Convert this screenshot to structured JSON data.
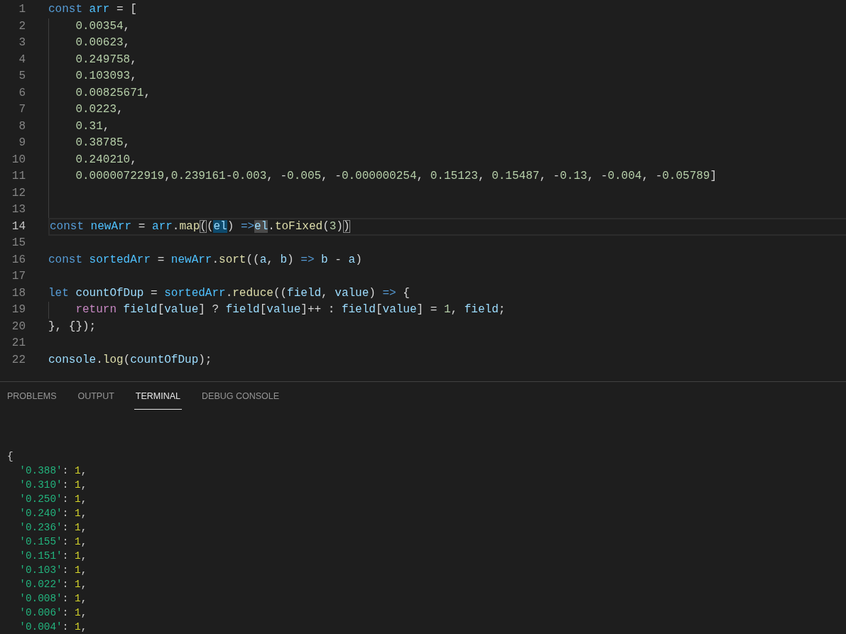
{
  "editor": {
    "lines": [
      {
        "line_number": "1",
        "current": false,
        "indented": false,
        "tokens": [
          {
            "text": "const ",
            "kind": "keyword"
          },
          {
            "text": "arr",
            "kind": "constant"
          },
          {
            "text": " = [",
            "kind": "punct"
          }
        ]
      },
      {
        "line_number": "2",
        "current": false,
        "indented": true,
        "tokens": [
          {
            "text": "0.00354",
            "kind": "number"
          },
          {
            "text": ",",
            "kind": "punct"
          }
        ]
      },
      {
        "line_number": "3",
        "current": false,
        "indented": true,
        "tokens": [
          {
            "text": "0.00623",
            "kind": "number"
          },
          {
            "text": ",",
            "kind": "punct"
          }
        ]
      },
      {
        "line_number": "4",
        "current": false,
        "indented": true,
        "tokens": [
          {
            "text": "0.249758",
            "kind": "number"
          },
          {
            "text": ",",
            "kind": "punct"
          }
        ]
      },
      {
        "line_number": "5",
        "current": false,
        "indented": true,
        "tokens": [
          {
            "text": "0.103093",
            "kind": "number"
          },
          {
            "text": ",",
            "kind": "punct"
          }
        ]
      },
      {
        "line_number": "6",
        "current": false,
        "indented": true,
        "tokens": [
          {
            "text": "0.00825671",
            "kind": "number"
          },
          {
            "text": ",",
            "kind": "punct"
          }
        ]
      },
      {
        "line_number": "7",
        "current": false,
        "indented": true,
        "tokens": [
          {
            "text": "0.0223",
            "kind": "number"
          },
          {
            "text": ",",
            "kind": "punct"
          }
        ]
      },
      {
        "line_number": "8",
        "current": false,
        "indented": true,
        "tokens": [
          {
            "text": "0.31",
            "kind": "number"
          },
          {
            "text": ",",
            "kind": "punct"
          }
        ]
      },
      {
        "line_number": "9",
        "current": false,
        "indented": true,
        "tokens": [
          {
            "text": "0.38785",
            "kind": "number"
          },
          {
            "text": ",",
            "kind": "punct"
          }
        ]
      },
      {
        "line_number": "10",
        "current": false,
        "indented": true,
        "tokens": [
          {
            "text": "0.240210",
            "kind": "number"
          },
          {
            "text": ",",
            "kind": "punct"
          }
        ]
      },
      {
        "line_number": "11",
        "current": false,
        "indented": true,
        "tokens": [
          {
            "text": "0.00000722919",
            "kind": "number"
          },
          {
            "text": ",",
            "kind": "punct"
          },
          {
            "text": "0.239161",
            "kind": "number"
          },
          {
            "text": "-",
            "kind": "punct"
          },
          {
            "text": "0.003",
            "kind": "number"
          },
          {
            "text": ", -",
            "kind": "punct"
          },
          {
            "text": "0.005",
            "kind": "number"
          },
          {
            "text": ", -",
            "kind": "punct"
          },
          {
            "text": "0.000000254",
            "kind": "number"
          },
          {
            "text": ", ",
            "kind": "punct"
          },
          {
            "text": "0.15123",
            "kind": "number"
          },
          {
            "text": ", ",
            "kind": "punct"
          },
          {
            "text": "0.15487",
            "kind": "number"
          },
          {
            "text": ", -",
            "kind": "punct"
          },
          {
            "text": "0.13",
            "kind": "number"
          },
          {
            "text": ", -",
            "kind": "punct"
          },
          {
            "text": "0.004",
            "kind": "number"
          },
          {
            "text": ", -",
            "kind": "punct"
          },
          {
            "text": "0.05789",
            "kind": "number"
          },
          {
            "text": "]",
            "kind": "punct"
          }
        ]
      },
      {
        "line_number": "12",
        "current": false,
        "indented": true
      },
      {
        "line_number": "13",
        "current": false,
        "indented": true
      },
      {
        "line_number": "14",
        "current": true,
        "indented": false,
        "tokens": [
          {
            "text": "const ",
            "kind": "keyword"
          },
          {
            "text": "newArr",
            "kind": "constant"
          },
          {
            "text": " = ",
            "kind": "punct"
          },
          {
            "text": "arr",
            "kind": "constant"
          },
          {
            "text": ".",
            "kind": "punct"
          },
          {
            "text": "map",
            "kind": "function"
          },
          {
            "text": "(",
            "kind": "punct",
            "matching_bracket": true
          },
          {
            "text": "(",
            "kind": "punct"
          },
          {
            "text": "el",
            "kind": "variable",
            "write_highlight": true
          },
          {
            "text": ") ",
            "kind": "punct"
          },
          {
            "text": "=>",
            "kind": "keyword"
          },
          {
            "text": "el",
            "kind": "variable",
            "read_highlight": true
          },
          {
            "text": ".",
            "kind": "punct"
          },
          {
            "text": "toFixed",
            "kind": "function"
          },
          {
            "text": "(",
            "kind": "punct"
          },
          {
            "text": "3",
            "kind": "number"
          },
          {
            "text": ")",
            "kind": "punct"
          },
          {
            "text": ")",
            "kind": "punct",
            "matching_bracket": true
          }
        ]
      },
      {
        "line_number": "15",
        "current": false,
        "indented": false
      },
      {
        "line_number": "16",
        "current": false,
        "indented": false,
        "tokens": [
          {
            "text": "const ",
            "kind": "keyword"
          },
          {
            "text": "sortedArr",
            "kind": "constant"
          },
          {
            "text": " = ",
            "kind": "punct"
          },
          {
            "text": "newArr",
            "kind": "constant"
          },
          {
            "text": ".",
            "kind": "punct"
          },
          {
            "text": "sort",
            "kind": "function"
          },
          {
            "text": "((",
            "kind": "punct"
          },
          {
            "text": "a",
            "kind": "variable"
          },
          {
            "text": ", ",
            "kind": "punct"
          },
          {
            "text": "b",
            "kind": "variable"
          },
          {
            "text": ") ",
            "kind": "punct"
          },
          {
            "text": "=> ",
            "kind": "keyword"
          },
          {
            "text": "b",
            "kind": "variable"
          },
          {
            "text": " - ",
            "kind": "punct"
          },
          {
            "text": "a",
            "kind": "variable"
          },
          {
            "text": ")",
            "kind": "punct"
          }
        ]
      },
      {
        "line_number": "17",
        "current": false,
        "indented": false
      },
      {
        "line_number": "18",
        "current": false,
        "indented": false,
        "tokens": [
          {
            "text": "let ",
            "kind": "keyword"
          },
          {
            "text": "countOfDup",
            "kind": "variable"
          },
          {
            "text": " = ",
            "kind": "punct"
          },
          {
            "text": "sortedArr",
            "kind": "constant"
          },
          {
            "text": ".",
            "kind": "punct"
          },
          {
            "text": "reduce",
            "kind": "function"
          },
          {
            "text": "((",
            "kind": "punct"
          },
          {
            "text": "field",
            "kind": "variable"
          },
          {
            "text": ", ",
            "kind": "punct"
          },
          {
            "text": "value",
            "kind": "variable"
          },
          {
            "text": ") ",
            "kind": "punct"
          },
          {
            "text": "=>",
            "kind": "keyword"
          },
          {
            "text": " {",
            "kind": "punct"
          }
        ]
      },
      {
        "line_number": "19",
        "current": false,
        "indented": true,
        "tokens": [
          {
            "text": "return ",
            "kind": "control"
          },
          {
            "text": "field",
            "kind": "variable"
          },
          {
            "text": "[",
            "kind": "punct"
          },
          {
            "text": "value",
            "kind": "variable"
          },
          {
            "text": "] ? ",
            "kind": "punct"
          },
          {
            "text": "field",
            "kind": "variable"
          },
          {
            "text": "[",
            "kind": "punct"
          },
          {
            "text": "value",
            "kind": "variable"
          },
          {
            "text": "]++ : ",
            "kind": "punct"
          },
          {
            "text": "field",
            "kind": "variable"
          },
          {
            "text": "[",
            "kind": "punct"
          },
          {
            "text": "value",
            "kind": "variable"
          },
          {
            "text": "] = ",
            "kind": "punct"
          },
          {
            "text": "1",
            "kind": "number"
          },
          {
            "text": ", ",
            "kind": "punct"
          },
          {
            "text": "field",
            "kind": "variable"
          },
          {
            "text": ";",
            "kind": "punct"
          }
        ]
      },
      {
        "line_number": "20",
        "current": false,
        "indented": false,
        "tokens": [
          {
            "text": "}, {});",
            "kind": "punct"
          }
        ]
      },
      {
        "line_number": "21",
        "current": false,
        "indented": false
      },
      {
        "line_number": "22",
        "current": false,
        "indented": false,
        "tokens": [
          {
            "text": "console",
            "kind": "variable"
          },
          {
            "text": ".",
            "kind": "punct"
          },
          {
            "text": "log",
            "kind": "function"
          },
          {
            "text": "(",
            "kind": "punct"
          },
          {
            "text": "countOfDup",
            "kind": "variable"
          },
          {
            "text": ");",
            "kind": "punct"
          }
        ]
      }
    ]
  },
  "panel": {
    "tabs": [
      {
        "label": "PROBLEMS",
        "selected": false
      },
      {
        "label": "OUTPUT",
        "selected": false
      },
      {
        "label": "TERMINAL",
        "selected": true
      },
      {
        "label": "DEBUG CONSOLE",
        "selected": false
      }
    ],
    "terminal": {
      "lines": [
        {
          "indented": false,
          "tokens": [
            {
              "text": "{",
              "kind": "punct"
            }
          ]
        },
        {
          "indented": true,
          "tokens": [
            {
              "text": "'0.388'",
              "kind": "string"
            },
            {
              "text": ": ",
              "kind": "punct"
            },
            {
              "text": "1",
              "kind": "number"
            },
            {
              "text": ",",
              "kind": "punct"
            }
          ]
        },
        {
          "indented": true,
          "tokens": [
            {
              "text": "'0.310'",
              "kind": "string"
            },
            {
              "text": ": ",
              "kind": "punct"
            },
            {
              "text": "1",
              "kind": "number"
            },
            {
              "text": ",",
              "kind": "punct"
            }
          ]
        },
        {
          "indented": true,
          "tokens": [
            {
              "text": "'0.250'",
              "kind": "string"
            },
            {
              "text": ": ",
              "kind": "punct"
            },
            {
              "text": "1",
              "kind": "number"
            },
            {
              "text": ",",
              "kind": "punct"
            }
          ]
        },
        {
          "indented": true,
          "tokens": [
            {
              "text": "'0.240'",
              "kind": "string"
            },
            {
              "text": ": ",
              "kind": "punct"
            },
            {
              "text": "1",
              "kind": "number"
            },
            {
              "text": ",",
              "kind": "punct"
            }
          ]
        },
        {
          "indented": true,
          "tokens": [
            {
              "text": "'0.236'",
              "kind": "string"
            },
            {
              "text": ": ",
              "kind": "punct"
            },
            {
              "text": "1",
              "kind": "number"
            },
            {
              "text": ",",
              "kind": "punct"
            }
          ]
        },
        {
          "indented": true,
          "tokens": [
            {
              "text": "'0.155'",
              "kind": "string"
            },
            {
              "text": ": ",
              "kind": "punct"
            },
            {
              "text": "1",
              "kind": "number"
            },
            {
              "text": ",",
              "kind": "punct"
            }
          ]
        },
        {
          "indented": true,
          "tokens": [
            {
              "text": "'0.151'",
              "kind": "string"
            },
            {
              "text": ": ",
              "kind": "punct"
            },
            {
              "text": "1",
              "kind": "number"
            },
            {
              "text": ",",
              "kind": "punct"
            }
          ]
        },
        {
          "indented": true,
          "tokens": [
            {
              "text": "'0.103'",
              "kind": "string"
            },
            {
              "text": ": ",
              "kind": "punct"
            },
            {
              "text": "1",
              "kind": "number"
            },
            {
              "text": ",",
              "kind": "punct"
            }
          ]
        },
        {
          "indented": true,
          "tokens": [
            {
              "text": "'0.022'",
              "kind": "string"
            },
            {
              "text": ": ",
              "kind": "punct"
            },
            {
              "text": "1",
              "kind": "number"
            },
            {
              "text": ",",
              "kind": "punct"
            }
          ]
        },
        {
          "indented": true,
          "tokens": [
            {
              "text": "'0.008'",
              "kind": "string"
            },
            {
              "text": ": ",
              "kind": "punct"
            },
            {
              "text": "1",
              "kind": "number"
            },
            {
              "text": ",",
              "kind": "punct"
            }
          ]
        },
        {
          "indented": true,
          "tokens": [
            {
              "text": "'0.006'",
              "kind": "string"
            },
            {
              "text": ": ",
              "kind": "punct"
            },
            {
              "text": "1",
              "kind": "number"
            },
            {
              "text": ",",
              "kind": "punct"
            }
          ]
        },
        {
          "indented": true,
          "tokens": [
            {
              "text": "'0.004'",
              "kind": "string"
            },
            {
              "text": ": ",
              "kind": "punct"
            },
            {
              "text": "1",
              "kind": "number"
            },
            {
              "text": ",",
              "kind": "punct"
            }
          ]
        }
      ]
    }
  }
}
